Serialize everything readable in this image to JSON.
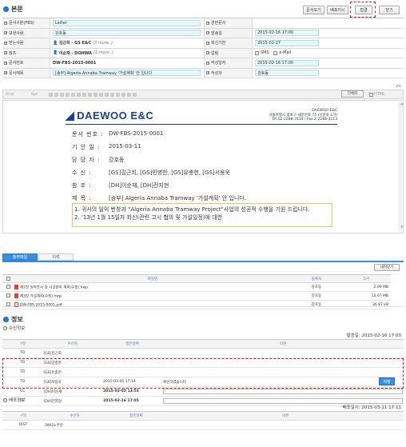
{
  "main_section": {
    "title": "본문"
  },
  "top_buttons": {
    "doc_view": "문서보기",
    "distribute": "배포지시",
    "approve": "접결",
    "close": "닫기"
  },
  "form": {
    "rows": [
      {
        "label": "문서구분(FBS)",
        "value": "Letter",
        "label2": "관련문서",
        "value2": ""
      },
      {
        "label": "보낸사람",
        "value": "강호동",
        "label2": "발송일",
        "value2": "2015-02-16 17:00"
      },
      {
        "label": "받는사람",
        "value": "김근희 - GS E&C",
        "value_more": "(3 more..)",
        "label2": "회신기한",
        "value2": "2015-02-27"
      },
      {
        "label": "참조",
        "value": "이순재 - DOHWA",
        "value_more": "(1 more..)",
        "label2": "알림",
        "value2_sms": "SMS",
        "value2_email": "e-Mail"
      },
      {
        "label": "문서번호",
        "value": "DW-FBS-2015-0001",
        "label2": "작성일자",
        "value2": "2015-02-16 17:00"
      },
      {
        "label": "문서제목",
        "value": "[송부] Algeria Annaba Tramway '가설계획' 안 입니다",
        "label2": "작성자",
        "value2": "강호동"
      }
    ]
  },
  "toolbar": {
    "font": "Arial",
    "size": "9pt",
    "fullscreen": "전체화",
    "html": "HTML"
  },
  "document": {
    "logo": "DAEWOO E&C",
    "addr1": "DAEWOO E&C",
    "addr2": "서울특별시 종로구 새문안로 75 (신문로 1가)",
    "addr3": "Tel.02-2288-3114 / Fax.2-2288-3113",
    "lines": [
      {
        "key": "문서 번호 :",
        "val": "DW-FBS-2015-0001"
      },
      {
        "key": "기 안 일 :",
        "val": "2015-03-11"
      },
      {
        "key": "담 당 자 :",
        "val": "강호동"
      },
      {
        "key": "수 신 :",
        "val": "[GS]김근희, [GS]민병한, [GS]유충헌, [GS]서용욱"
      },
      {
        "key": "참 조 :",
        "val": "[DH]이순재, [DH]전지현"
      },
      {
        "key": "제 목 :",
        "val": "[송부] Algeria Annaba Tramway '가설계획' 안 입니다."
      }
    ],
    "body1": "1. 귀사의 일익 번창과 \"Algeria Annaba Tramway Project\"사업의 성공적 수행을 기원 드립니다.",
    "body2": "2. '13년 1월 15일자 회신(관련 고시 협의 및 가설일정)에 대한"
  },
  "tabs": {
    "attached": "첨부파일",
    "history": "이력"
  },
  "attach": {
    "download": "내려받기",
    "headers": {
      "file": "파일명",
      "registrant": "등록자",
      "size": "크기"
    },
    "rows": [
      {
        "file": "제2장 원자조사 및 시공관리 계획(수정).hwp",
        "registrant": "강호동",
        "size": "2.99 MB"
      },
      {
        "file": "제3장 가설계획(수정).hwp",
        "registrant": "강호동",
        "size": "15.67 MB"
      },
      {
        "file": "DW-FBS-2015-0001.pdf",
        "registrant": "강호동",
        "size": "36.87 kB"
      }
    ]
  },
  "info_section": {
    "title": "정보"
  },
  "reception": {
    "title": "수신정보",
    "sent": "발송일: 2015-02-16 17:00",
    "headers": {
      "kind": "구분",
      "recipient": "수신자",
      "confirmed": "접은날짜",
      "opinion": "의견"
    },
    "rows": [
      {
        "kind": "TO",
        "recipient": "[GS]김근희",
        "confirmed": "",
        "opinion": ""
      },
      {
        "kind": "TO",
        "recipient": "[GS]민병한",
        "confirmed": "",
        "opinion": ""
      },
      {
        "kind": "TO",
        "recipient": "[GS]유충헌",
        "confirmed": "",
        "opinion": ""
      },
      {
        "kind": "TO",
        "recipient": "[GS]서용욱",
        "confirmed": "2015-03-05 17:14",
        "opinion": "확인하였습니다"
      },
      {
        "kind": "CC",
        "recipient": "[DH]이순재",
        "confirmed": "2015-03-05 13:53",
        "opinion": ""
      },
      {
        "kind": "CC",
        "recipient": "[DH]전지현",
        "confirmed": "2015-02-16 17:05",
        "opinion": ""
      }
    ],
    "save": "저장"
  },
  "distribution": {
    "title": "배포정보",
    "stamp": "배포일시: 2015-03-11 17:11",
    "headers": {
      "kind": "구분",
      "recipient": "수신자",
      "confirmed": "접은날짜",
      "opinion": "의견"
    },
    "rows": [
      {
        "kind": "DIST",
        "recipient": "[MA]노주원",
        "confirmed": "",
        "opinion": ""
      }
    ]
  }
}
